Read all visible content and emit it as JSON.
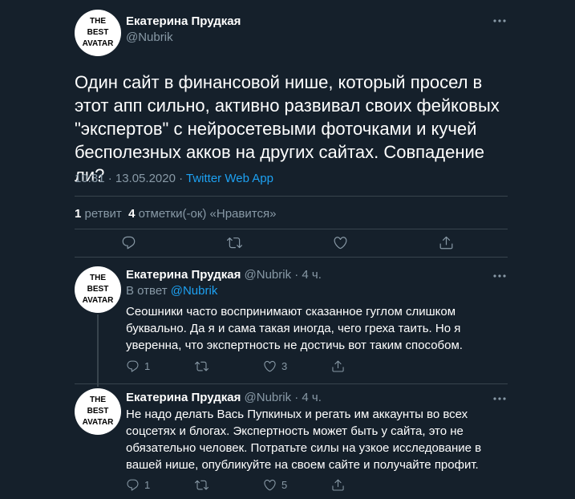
{
  "main_tweet": {
    "name": "Екатерина Прудкая",
    "handle": "@Nubrik",
    "text": "Один сайт в финансовой нише, который просел в этот апп сильно, активно развивал своих фейковых \"экспертов\" с нейросетевыми фоточками и кучей бесполезных акков на других сайтах. Совпадение ли?",
    "time": "10:31 · 13.05.2020 · ",
    "app": "Twitter Web App",
    "retweets_count": "1",
    "retweets_label": " ретвит  ",
    "likes_count": "4",
    "likes_label": " отметки(-ок) «Нравится»"
  },
  "avatar": {
    "line1": "THE",
    "line2": "BEST",
    "line3": "AVATAR"
  },
  "replies": [
    {
      "name": "Екатерина Прудкая",
      "handle_time": " @Nubrik · 4 ч.",
      "reply_to_prefix": "В ответ ",
      "reply_to_mention": "@Nubrik",
      "text": "Сеошники часто воспринимают сказанное гуглом слишком буквально. Да я и сама такая иногда, чего греха таить. Но я уверенна, что экспертность не достичь вот таким способом.",
      "reply_count": "1",
      "retweet_count": "",
      "like_count": "3"
    },
    {
      "name": "Екатерина Прудкая",
      "handle_time": " @Nubrik · 4 ч.",
      "text": "Не надо делать Вась Пупкиных и регать им аккаунты во всех соцсетях и блогах. Экспертность может быть у сайта, это не обязательно человек. Потратьте силы на узкое исследование в вашей нише, опубликуйте на своем сайте и получайте профит.",
      "reply_count": "1",
      "retweet_count": "",
      "like_count": "5"
    }
  ],
  "icons": {
    "reply": "reply-icon",
    "retweet": "retweet-icon",
    "like": "heart-icon",
    "share": "share-icon",
    "more": "more-icon"
  },
  "colors": {
    "background": "#15202b",
    "text": "#ffffff",
    "secondary": "#8899a6",
    "accent": "#1da1f2",
    "divider": "#38444d"
  }
}
